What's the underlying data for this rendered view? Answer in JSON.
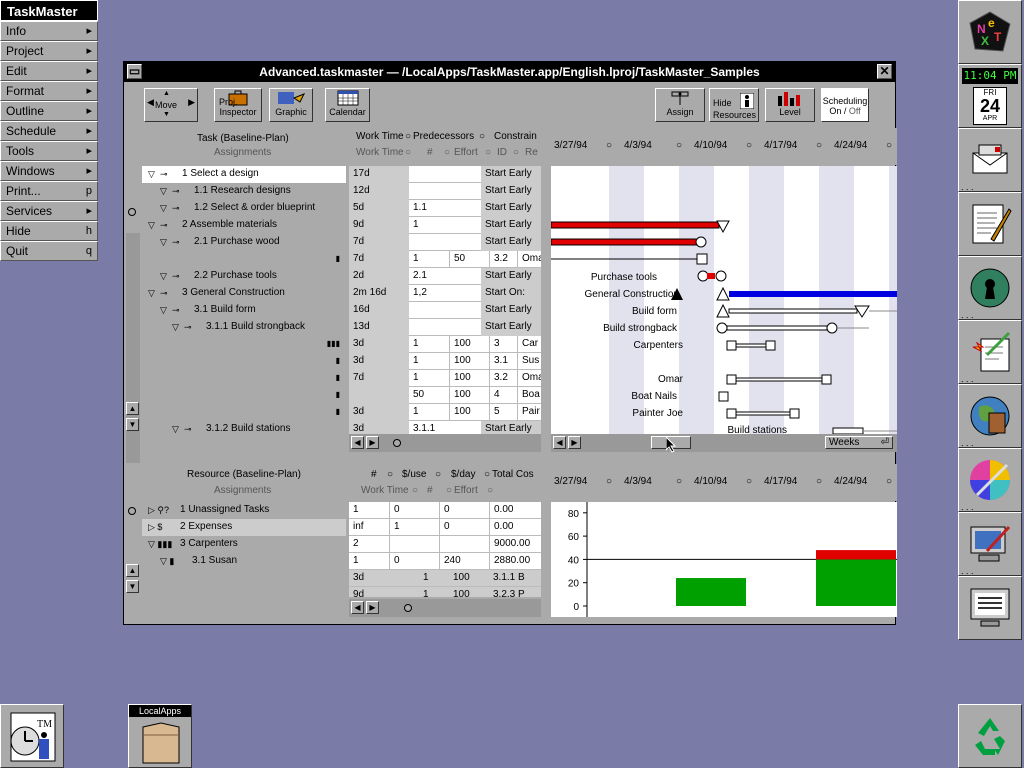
{
  "menu": {
    "title": "TaskMaster",
    "items": [
      {
        "label": "Info",
        "key": "▸"
      },
      {
        "label": "Project",
        "key": "▸"
      },
      {
        "label": "Edit",
        "key": "▸"
      },
      {
        "label": "Format",
        "key": "▸"
      },
      {
        "label": "Outline",
        "key": "▸"
      },
      {
        "label": "Schedule",
        "key": "▸"
      },
      {
        "label": "Tools",
        "key": "▸"
      },
      {
        "label": "Windows",
        "key": "▸"
      },
      {
        "label": "Print...",
        "key": "p"
      },
      {
        "label": "Services",
        "key": "▸"
      },
      {
        "label": "Hide",
        "key": "h"
      },
      {
        "label": "Quit",
        "key": "q"
      }
    ]
  },
  "window": {
    "title": "Advanced.taskmaster  —  /LocalApps/TaskMaster.app/English.lproj/TaskMaster_Samples",
    "close": "✕"
  },
  "toolbar": {
    "move": "Move",
    "proj_inspector_1": "Proj.",
    "proj_inspector_2": "Inspector",
    "graphic": "Graphic",
    "calendar": "Calendar",
    "assign": "Assign",
    "hide_resources_1": "Hide",
    "hide_resources_2": "Resources",
    "level": "Level",
    "scheduling_1": "Scheduling",
    "scheduling_on": "On",
    "scheduling_sep": " / ",
    "scheduling_off": "Off"
  },
  "task_header": {
    "col1": "Task (Baseline-Plan)",
    "col1b": "Assignments",
    "work_time": "Work Time",
    "predecessors": "Predecessors",
    "constraint": "Constrain",
    "work_time_b": "Work Time",
    "hash": "#",
    "effort": "Effort",
    "id": "ID",
    "re": "Re"
  },
  "dates": [
    "3/27/94",
    "4/3/94",
    "4/10/94",
    "4/17/94",
    "4/24/94"
  ],
  "tasks": [
    {
      "label": "1   Select a design",
      "work": "17d",
      "pred": "",
      "c3": "",
      "c4": "",
      "c5": "",
      "constraint": "Start Early"
    },
    {
      "label": "1.1  Research designs",
      "work": "12d",
      "pred": "",
      "c3": "",
      "c4": "",
      "c5": "",
      "constraint": "Start Early"
    },
    {
      "label": "1.2  Select & order blueprint",
      "work": "5d",
      "pred": "1.1",
      "c3": "",
      "c4": "",
      "c5": "",
      "constraint": "Start Early"
    },
    {
      "label": "2   Assemble materials",
      "work": "9d",
      "pred": "1",
      "c3": "",
      "c4": "",
      "c5": "",
      "constraint": "Start Early"
    },
    {
      "label": "2.1  Purchase wood",
      "work": "7d",
      "pred": "",
      "c3": "",
      "c4": "",
      "c5": "",
      "constraint": "Start Early"
    },
    {
      "label": "",
      "work": "7d",
      "pred": "1",
      "c3": "50",
      "c4": "3.2",
      "c5": "Oma",
      "constraint": ""
    },
    {
      "label": "2.2  Purchase tools",
      "work": "2d",
      "pred": "2.1",
      "c3": "",
      "c4": "",
      "c5": "",
      "constraint": "Start Early"
    },
    {
      "label": "3   General Construction",
      "work": "2m 16d",
      "pred": "1,2",
      "c3": "",
      "c4": "",
      "c5": "",
      "constraint": "Start On:"
    },
    {
      "label": "3.1  Build form",
      "work": "16d",
      "pred": "",
      "c3": "",
      "c4": "",
      "c5": "",
      "constraint": "Start Early"
    },
    {
      "label": "3.1.1  Build strongback",
      "work": "13d",
      "pred": "",
      "c3": "",
      "c4": "",
      "c5": "",
      "constraint": "Start Early"
    },
    {
      "label": "",
      "work": "3d",
      "pred": "1",
      "c3": "100",
      "c4": "3",
      "c5": "Car",
      "constraint": ""
    },
    {
      "label": "",
      "work": "3d",
      "pred": "1",
      "c3": "100",
      "c4": "3.1",
      "c5": "Sus",
      "constraint": ""
    },
    {
      "label": "",
      "work": "7d",
      "pred": "1",
      "c3": "100",
      "c4": "3.2",
      "c5": "Oma",
      "constraint": ""
    },
    {
      "label": "",
      "work": "",
      "pred": "50",
      "c3": "100",
      "c4": "4",
      "c5": "Boa",
      "constraint": ""
    },
    {
      "label": "",
      "work": "3d",
      "pred": "1",
      "c3": "100",
      "c4": "5",
      "c5": "Pair",
      "constraint": ""
    },
    {
      "label": "3.1.2  Build stations",
      "work": "3d",
      "pred": "3.1.1",
      "c3": "",
      "c4": "",
      "c5": "",
      "constraint": "Start Early"
    }
  ],
  "gantt_labels": [
    "Purchase tools",
    "General Construction",
    "Build form",
    "Build strongback",
    "Carpenters",
    "Omar",
    "Boat Nails",
    "Painter Joe",
    "Build stations"
  ],
  "weeks_popup": "Weeks",
  "resource_header": {
    "col1": "Resource (Baseline-Plan)",
    "col1b": "Assignments",
    "hash": "#",
    "use": "$/use",
    "day": "$/day",
    "total": "Total Cos",
    "work_time": "Work Time",
    "hash_b": "#",
    "effort": "Effort"
  },
  "resources": [
    {
      "label": "1  Unassigned Tasks",
      "c1": "1",
      "c2": "0",
      "c3": "0",
      "c4": "0.00"
    },
    {
      "label": "2  Expenses",
      "c1": "inf",
      "c2": "1",
      "c3": "0",
      "c4": "0.00"
    },
    {
      "label": "3  Carpenters",
      "c1": "2",
      "c2": "",
      "c3": "",
      "c4": "9000.00"
    },
    {
      "label": "3.1  Susan",
      "c1": "1",
      "c2": "0",
      "c3": "240",
      "c4": "2880.00"
    }
  ],
  "resource_extra": [
    {
      "c1": "3d",
      "c2": "1",
      "c3": "100",
      "c4": "3.1.1  B"
    },
    {
      "c1": "9d",
      "c2": "1",
      "c3": "100",
      "c4": "3.2.3  P"
    }
  ],
  "histogram": {
    "yticks": [
      "80",
      "60",
      "40",
      "20",
      "0"
    ]
  },
  "chart_data": {
    "type": "bar",
    "categories": [
      "3/27/94",
      "4/3/94",
      "4/10/94",
      "4/17/94",
      "4/24/94"
    ],
    "series": [
      {
        "values": [
          0,
          24,
          0,
          40,
          0
        ],
        "color": "#00a000"
      },
      {
        "values": [
          0,
          0,
          0,
          8,
          0
        ],
        "color": "#e00000"
      }
    ],
    "ylim": [
      0,
      85
    ]
  },
  "clock": {
    "time": "11:04 PM",
    "day": "FRI",
    "date": "24",
    "month": "APR"
  },
  "shelf": {
    "label": "LocalApps"
  },
  "colors": {
    "desktop": "#7b7ba7",
    "panel": "#aaaaaa",
    "red": "#e00000",
    "blue": "#0000e0",
    "green": "#00a000"
  }
}
